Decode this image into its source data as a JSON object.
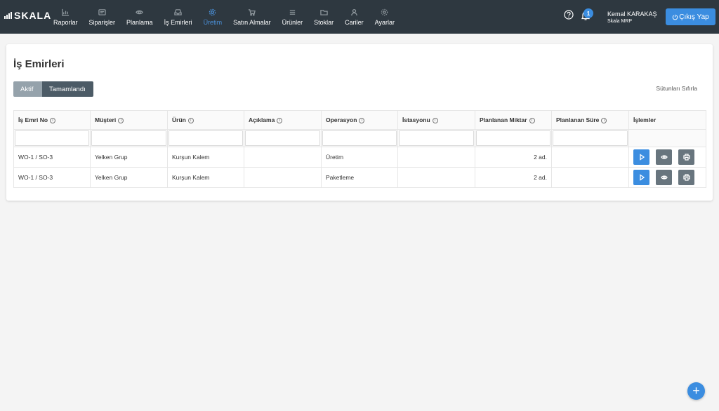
{
  "app": {
    "logo_text": "SKALA"
  },
  "nav": [
    {
      "label": "Raporlar",
      "icon": "chart-icon",
      "active": false
    },
    {
      "label": "Siparişler",
      "icon": "orders-icon",
      "active": false
    },
    {
      "label": "Planlama",
      "icon": "eye-icon",
      "active": false
    },
    {
      "label": "İş Emirleri",
      "icon": "inbox-icon",
      "active": false
    },
    {
      "label": "Üretim",
      "icon": "gear-icon",
      "active": true
    },
    {
      "label": "Satın Almalar",
      "icon": "cart-icon",
      "active": false
    },
    {
      "label": "Ürünler",
      "icon": "list-icon",
      "active": false
    },
    {
      "label": "Stoklar",
      "icon": "folder-icon",
      "active": false
    },
    {
      "label": "Cariler",
      "icon": "user-icon",
      "active": false
    },
    {
      "label": "Ayarlar",
      "icon": "settings-icon",
      "active": false
    }
  ],
  "header": {
    "notification_count": "1",
    "user_name": "Kemal KARAKAŞ",
    "user_org": "Skala MRP",
    "logout_label": "Çıkış Yap"
  },
  "page": {
    "title": "İş Emirleri",
    "toggle_active": "Aktif",
    "toggle_done": "Tamamlandı",
    "reset_columns": "Sütunları Sıfırla"
  },
  "table": {
    "columns": [
      "İş Emri No",
      "Müşteri",
      "Ürün",
      "Açıklama",
      "Operasyon",
      "İstasyonu",
      "Planlanan Miktar",
      "Planlanan Süre",
      "İşlemler"
    ],
    "rows": [
      [
        "WO-1 / SO-3",
        "Yelken Grup",
        "Kurşun Kalem",
        "",
        "Üretim",
        "",
        "2 ad.",
        ""
      ],
      [
        "WO-1 / SO-3",
        "Yelken Grup",
        "Kurşun Kalem",
        "",
        "Paketleme",
        "",
        "2 ad.",
        ""
      ]
    ]
  },
  "fab": {
    "label": "+"
  },
  "colors": {
    "topbar": "#2e3840",
    "accent": "#3b8de0",
    "active_nav": "#4a90d9"
  }
}
